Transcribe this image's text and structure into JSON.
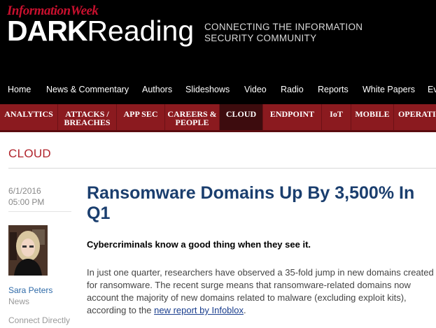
{
  "header": {
    "publisher": "InformationWeek",
    "logo_dark": "DARK",
    "logo_reading": "Reading",
    "tagline": "CONNECTING THE INFORMATION SECURITY COMMUNITY"
  },
  "nav_primary": [
    "Home",
    "News & Commentary",
    "Authors",
    "Slideshows",
    "Video",
    "Radio",
    "Reports",
    "White Papers",
    "Ev"
  ],
  "nav_sections": [
    {
      "line1": "ANALYTICS",
      "line2": ""
    },
    {
      "line1": "ATTACKS /",
      "line2": "BREACHES"
    },
    {
      "line1": "APP SEC",
      "line2": ""
    },
    {
      "line1": "CAREERS &",
      "line2": "PEOPLE"
    },
    {
      "line1": "CLOUD",
      "line2": ""
    },
    {
      "line1": "ENDPOINT",
      "line2": ""
    },
    {
      "line1": "IoT",
      "line2": ""
    },
    {
      "line1": "MOBILE",
      "line2": ""
    },
    {
      "line1": "OPERATIO",
      "line2": ""
    }
  ],
  "active_section_index": 4,
  "page": {
    "section_title": "CLOUD",
    "date": "6/1/2016",
    "time": "05:00 PM",
    "author_name": "Sara Peters",
    "author_role": "News",
    "connect_label": "Connect Directly"
  },
  "article": {
    "headline": "Ransomware Domains Up By 3,500% In Q1",
    "subhead": "Cybercriminals know a good thing when they see it.",
    "body_before_link": "In just one quarter, researchers have observed a 35-fold jump in new domains created for ransomware. The recent surge means that ransomware-related domains now account the majority of new domains related to malware (excluding exploit kits), according to the ",
    "link_text": "new report by Infoblox",
    "body_after_link": "."
  },
  "colors": {
    "brand_red": "#c8102e",
    "section_bar": "#8b1a1f",
    "headline_blue": "#1a3e6e"
  }
}
